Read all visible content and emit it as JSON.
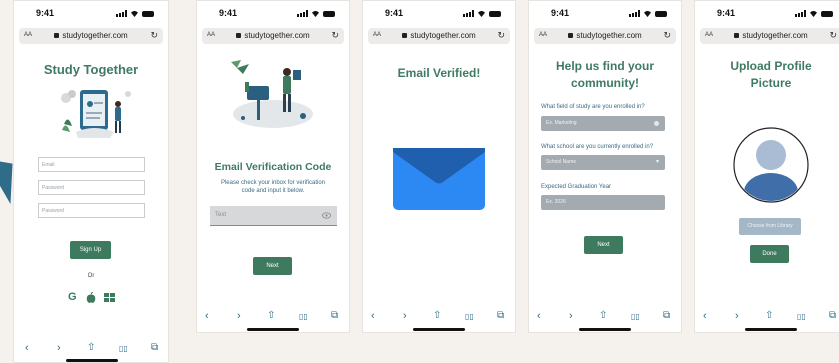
{
  "status": {
    "time": "9:41"
  },
  "browser": {
    "text_size": "AA",
    "url": "studytogether.com"
  },
  "toolbar": {
    "back": "‹",
    "forward": "›",
    "share": "⇧",
    "bookmarks": "▯▯",
    "tabs": "⧉"
  },
  "screens": {
    "signup": {
      "title": "Study Together",
      "email_placeholder": "Email",
      "password_placeholder": "Password",
      "confirm_placeholder": "Password",
      "signup_button": "Sign Up",
      "or_text": "Or",
      "social": [
        "G",
        "",
        ""
      ]
    },
    "verification": {
      "title": "Email Verification Code",
      "instructions": "Please check your inbox for verification code and input it below.",
      "code_placeholder": "Text",
      "next_button": "Next"
    },
    "verified": {
      "title": "Email Verified!"
    },
    "community": {
      "title": "Help us find your community!",
      "q1_label": "What field of study are you enrolled in?",
      "q1_placeholder": "Ex. Marketing",
      "q2_label": "What school are you currently enrolled in?",
      "q2_placeholder": "School Name",
      "q3_label": "Expected Graduation Year",
      "q3_placeholder": "Ex. 2026",
      "next_button": "Next"
    },
    "profile": {
      "title": "Upload Profile Picture",
      "choose_button": "Choose from Library",
      "done_button": "Done"
    }
  },
  "colors": {
    "accent_green": "#3e7a5d",
    "title_green": "#3f7a62",
    "link_blue": "#2f6c8a",
    "envelope_blue": "#2c88f3",
    "envelope_flap": "#1f5fae",
    "avatar_blue": "#3f6ea9",
    "background": "#f5f1ec"
  }
}
